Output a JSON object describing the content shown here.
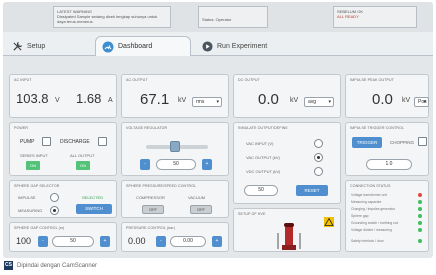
{
  "topbar": {
    "box1": "LATEST WARNING",
    "box1_text": "Dissipated Sample sedang dicek lengkap suhunya untuk daya terus-menerus",
    "box2": "Status: Operator",
    "box3": "SEBELUM OK",
    "box3_alert": "ALL READY"
  },
  "tabs": {
    "setup": "Setup",
    "dashboard": "Dashboard",
    "run": "Run Experiment"
  },
  "ac_input": {
    "title": "AC INPUT",
    "voltage": "103.8",
    "voltage_unit": "V",
    "current": "1.68",
    "current_unit": "A"
  },
  "ac_output": {
    "title": "AC OUTPUT",
    "value": "67.1",
    "unit": "kV",
    "mode": "rms"
  },
  "dc_output": {
    "title": "DC OUTPUT",
    "value": "0.0",
    "unit": "kV",
    "mode": "avg"
  },
  "impulse_output": {
    "title": "IMPULSE PEAK OUTPUT",
    "value": "0.0",
    "unit": "kV",
    "mode": "Pos"
  },
  "power": {
    "title": "POWER",
    "pump": "PUMP",
    "discharge": "DISCHARGE",
    "series_input": "SERIES INPUT",
    "all_output": "ALL OUTPUT",
    "on1": "ON",
    "on2": "ON"
  },
  "voltage_regulator": {
    "title": "VOLTAGE REGULATOR",
    "value": "50",
    "minus": "-",
    "plus": "+"
  },
  "output_selector": {
    "title": "SIMULATE OUTPUT/DEFINE",
    "vac_input": "VAC INPUT (V)",
    "vac_output": "VAC OUTPUT (kV)",
    "vdc_output": "VDC OUTPUT (kV)",
    "value": "50",
    "btn": "RESET"
  },
  "impulse_trigger": {
    "title": "IMPULSE TRIGGER CONTROL",
    "trigger": "TRIGGER",
    "chopping": "CHOPPING",
    "value": "1.0"
  },
  "sphere_gap": {
    "title": "SPHERE GAP SELECTOR",
    "impulse": "IMPULSE",
    "measuring": "MEASURING",
    "selected": "SELECTED",
    "btn": "SWITCH"
  },
  "sphere_pressure": {
    "title": "SPHERE PRESSURE/SPEED CONTROL",
    "compressor": "COMPRESSOR",
    "vacuum": "VACUUM",
    "off1": "OFF",
    "off2": "OFF"
  },
  "sphere_gap_control": {
    "title": "SPHERE GAP CONTROL (m)",
    "value": "100",
    "setpoint": "50"
  },
  "pressure_control": {
    "title": "PRESSURE CONTROL (bar)",
    "value": "0.00",
    "setpoint": "0.00"
  },
  "setup_image": {
    "title": "SETUP OF HVE"
  },
  "lamps": {
    "title": "CONNECTION STATUS",
    "items": [
      "Voltage transformer unit",
      "Measuring capacitor",
      "Charging / Impulse generator",
      "Sphere gap",
      "Grounding switch / earthing rod",
      "Voltage divider / measuring",
      "Safety interlock / door"
    ]
  },
  "caption": {
    "badge": "CS",
    "text": "Dipindai dengan CamScanner"
  }
}
